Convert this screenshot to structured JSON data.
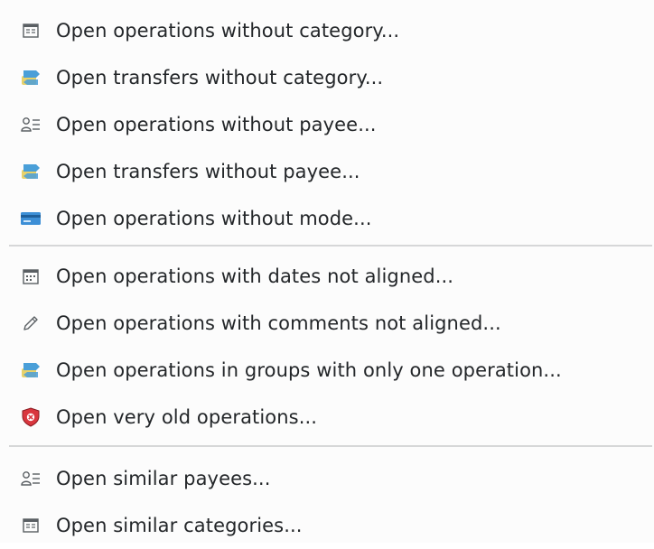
{
  "menu": {
    "items": [
      {
        "label": "Open operations without category...",
        "icon": "categories-icon"
      },
      {
        "label": "Open transfers without category...",
        "icon": "transfer-icon"
      },
      {
        "label": "Open operations without payee...",
        "icon": "payee-icon"
      },
      {
        "label": "Open transfers without payee...",
        "icon": "transfer-icon"
      },
      {
        "label": "Open operations without mode...",
        "icon": "credit-card-icon"
      },
      {
        "label": "Open operations with dates not aligned...",
        "icon": "calendar-icon"
      },
      {
        "label": "Open operations with comments not aligned...",
        "icon": "pencil-icon"
      },
      {
        "label": "Open operations in groups with only one operation...",
        "icon": "transfer-icon"
      },
      {
        "label": "Open very old operations...",
        "icon": "shield-icon"
      },
      {
        "label": "Open similar payees...",
        "icon": "payee-icon"
      },
      {
        "label": "Open similar categories...",
        "icon": "categories-icon"
      }
    ]
  },
  "colors": {
    "text": "#232629",
    "separator": "#d6d7d8",
    "transfer_blue": "#4a9fd8",
    "transfer_yellow": "#e8d26a",
    "card_blue": "#3d8fd6",
    "shield_red": "#d9363e"
  }
}
